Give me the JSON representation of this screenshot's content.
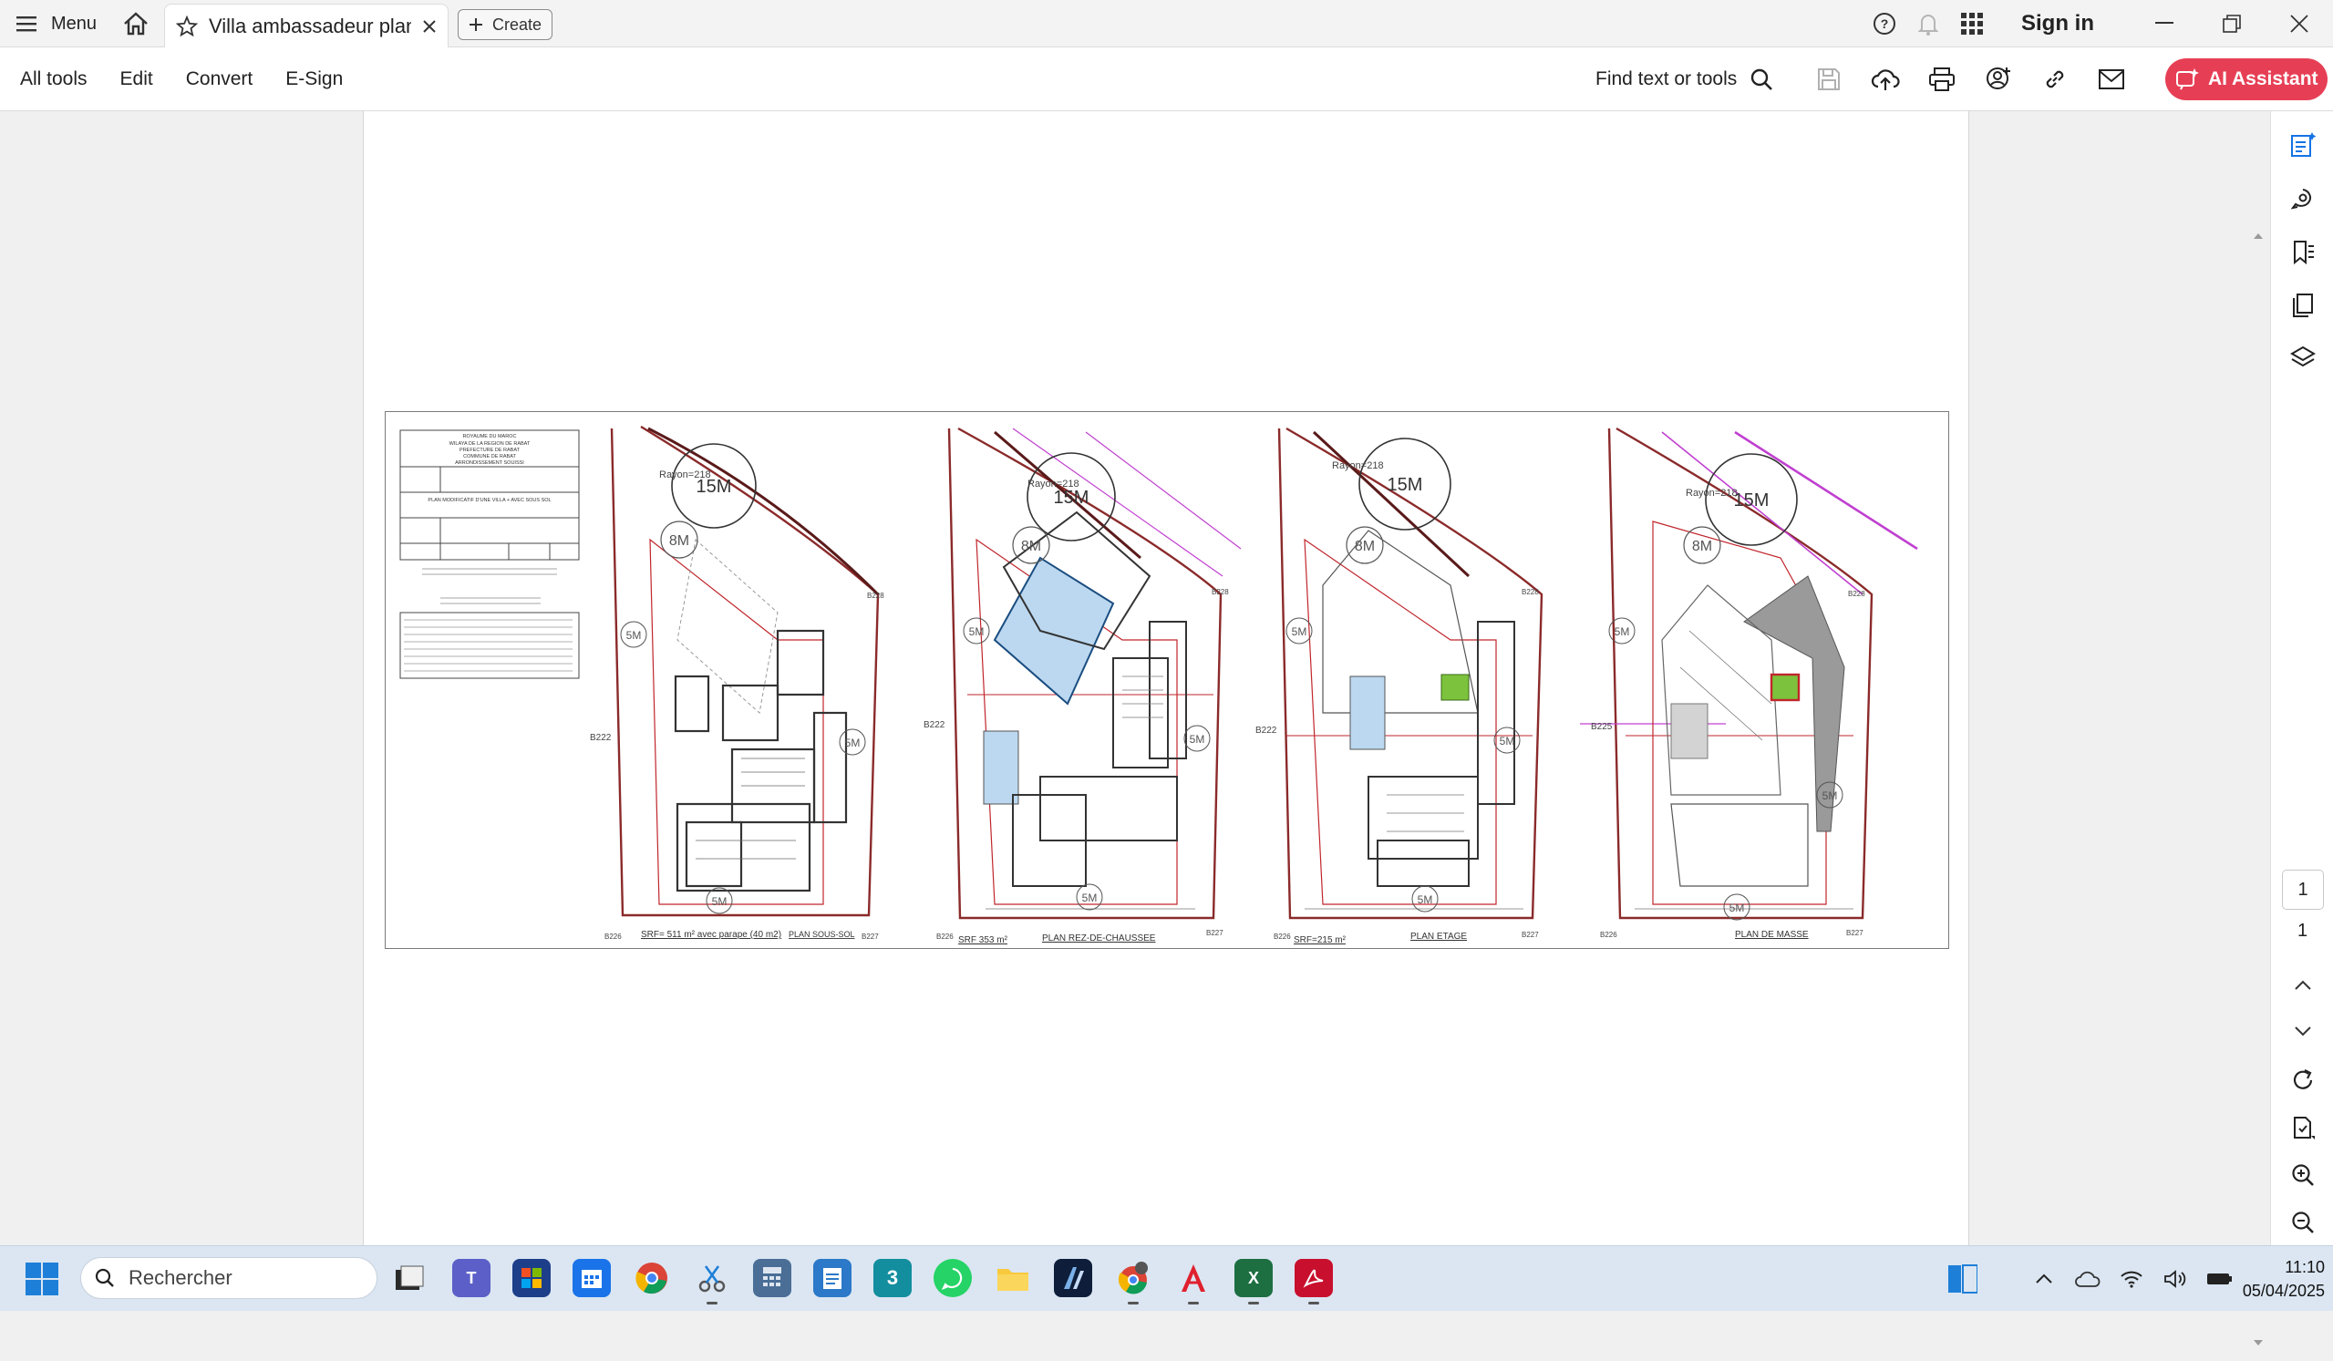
{
  "titlebar": {
    "menu_label": "Menu",
    "tab_title": "Villa ambassadeur plan...",
    "create_label": "Create",
    "signin_label": "Sign in"
  },
  "commandbar": {
    "all_tools": "All tools",
    "edit": "Edit",
    "convert": "Convert",
    "esign": "E-Sign",
    "find_label": "Find text or tools",
    "ai_label": "AI Assistant"
  },
  "colors": {
    "accent_blue": "#1473e6",
    "ai_red": "#e63f55",
    "plan_red": "#c0262c",
    "plan_magenta": "#c040d0",
    "pool_blue": "#bcd8f0",
    "green_mark": "#7cc23c"
  },
  "drawing": {
    "cartouche_lines": [
      "ROYAUME DU MAROC",
      "WILAYA DE LA REGION DE RABAT",
      "PREFECTURE DE RABAT",
      "COMMUNE DE RABAT",
      "ARRONDISSEMENT SOUISSI",
      "PLAN MODIFICATIF D'UNE VILLA + AVEC SOUS SOL"
    ],
    "plans": [
      {
        "circle_big": "15M",
        "circle_mid": "8M",
        "rayon": "Rayon=218",
        "side_a": "5M",
        "side_b": "5M",
        "bottom": "5M",
        "b_left": "B222",
        "b_right": "B228",
        "b_bl": "B226",
        "b_br": "B227",
        "srf": "SRF= 511 m² avec parape (40 m2)",
        "title": "PLAN SOUS-SOL"
      },
      {
        "circle_big": "15M",
        "circle_mid": "8M",
        "rayon": "Rayon=218",
        "side_a": "5M",
        "side_b": "5M",
        "bottom": "5M",
        "b_left": "B222",
        "b_right": "B228",
        "b_bl": "B226",
        "b_br": "B227",
        "srf": "SRF 353 m²",
        "title": "PLAN REZ-DE-CHAUSSEE"
      },
      {
        "circle_big": "15M",
        "circle_mid": "8M",
        "rayon": "Rayon=218",
        "side_a": "5M",
        "side_b": "5M",
        "bottom": "5M",
        "b_left": "B222",
        "b_right": "B228",
        "b_bl": "B226",
        "b_br": "B227",
        "srf": "SRF=215 m²",
        "title": "PLAN ETAGE"
      },
      {
        "circle_big": "15M",
        "circle_mid": "8M",
        "rayon": "Rayon=218",
        "side_a": "5M",
        "side_b": "5M",
        "bottom": "5M",
        "b_left": "B225",
        "b_right": "B228",
        "b_bl": "B226",
        "b_br": "B227",
        "srf": "",
        "title": "PLAN DE MASSE"
      }
    ]
  },
  "navigation": {
    "current_page": "1",
    "total_pages": "1"
  },
  "taskbar": {
    "search_placeholder": "Rechercher",
    "time": "11:10",
    "date": "05/04/2025",
    "apps": [
      "file-explorer-icon",
      "teams-icon",
      "store-icon",
      "calendar-icon",
      "chrome-icon",
      "snipping-tool-icon",
      "calculator-icon",
      "notepad-icon",
      "3dsmax-icon",
      "whatsapp-icon",
      "folder-icon",
      "autocad-icon",
      "chrome-profile-icon",
      "acrobat-icon",
      "excel-icon",
      "acrobat-reader-icon"
    ]
  }
}
